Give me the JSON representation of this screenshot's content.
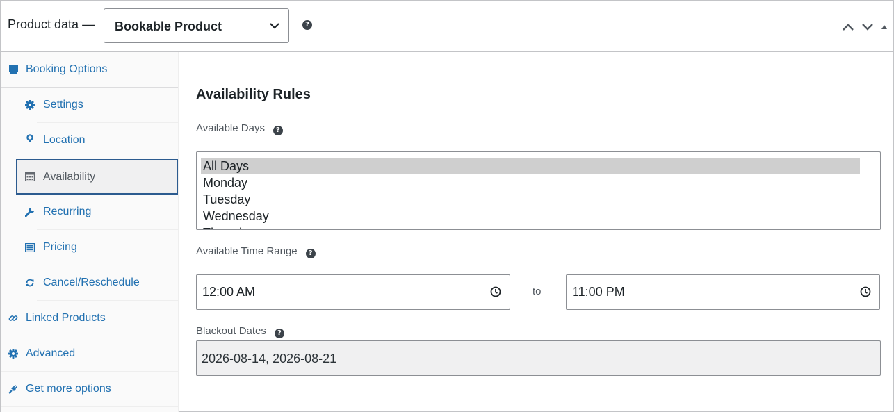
{
  "header": {
    "title": "Product data —",
    "product_type": "Bookable Product",
    "help_icon": "question-circle-icon",
    "arrows": [
      "chevron-up-icon",
      "chevron-down-icon",
      "triangle-up-icon"
    ]
  },
  "sidebar": {
    "items": [
      {
        "label": "Booking Options",
        "icon": "book-icon"
      },
      {
        "label": "Settings",
        "icon": "gear-icon"
      },
      {
        "label": "Location",
        "icon": "map-pin-icon"
      },
      {
        "label": "Availability",
        "icon": "calendar-icon",
        "active": true
      },
      {
        "label": "Recurring",
        "icon": "wrench-icon"
      },
      {
        "label": "Pricing",
        "icon": "list-icon"
      },
      {
        "label": "Cancel/Reschedule",
        "icon": "refresh-icon"
      },
      {
        "label": "Linked Products",
        "icon": "link-icon"
      },
      {
        "label": "Advanced",
        "icon": "gear-icon"
      },
      {
        "label": "Get more options",
        "icon": "plugin-icon"
      }
    ]
  },
  "main": {
    "heading": "Availability Rules",
    "available_days": {
      "label": "Available Days",
      "options": [
        "All Days",
        "Monday",
        "Tuesday",
        "Wednesday",
        "Thursday"
      ],
      "selected": "All Days"
    },
    "time_range": {
      "label": "Available Time Range",
      "from": "12:00 AM",
      "separator": "to",
      "to": "11:00 PM"
    },
    "blackout": {
      "label": "Blackout Dates",
      "value": "2026-08-14, 2026-08-21"
    }
  },
  "colors": {
    "link": "#2271b1",
    "active_border": "#2c5b8f",
    "selected_option": "#cfcfcf",
    "readonly_bg": "#f0f0f1"
  }
}
